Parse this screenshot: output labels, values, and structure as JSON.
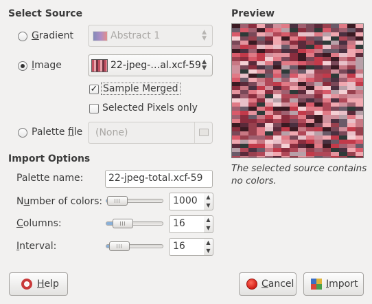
{
  "select_source": {
    "title": "Select Source",
    "gradient": {
      "label": "Gradient",
      "value": "Abstract 1",
      "checked": false
    },
    "image": {
      "label": "Image",
      "value": "22-jpeg-…al.xcf-59",
      "checked": true
    },
    "sample_merged": {
      "label": "Sample Merged",
      "checked": true
    },
    "selected_pixels_only": {
      "label": "Selected Pixels only",
      "checked": false
    },
    "palette_file": {
      "label": "Palette file",
      "value": "(None)",
      "checked": false
    }
  },
  "preview": {
    "title": "Preview",
    "caption_line1": "The selected source contains",
    "caption_line2": "no colors."
  },
  "import_options": {
    "title": "Import Options",
    "palette_name": {
      "label": "Palette name:",
      "value": "22-jpeg-total.xcf-59"
    },
    "number_of_colors": {
      "label": "Number of colors:",
      "value": "1000",
      "level": 0.02
    },
    "columns": {
      "label": "Columns:",
      "value": "16",
      "level": 0.12
    },
    "interval": {
      "label": "Interval:",
      "value": "16",
      "level": 0.06
    }
  },
  "buttons": {
    "help": "Help",
    "cancel": "Cancel",
    "import": "Import"
  },
  "icons": {
    "help": "help-lifebuoy-icon",
    "cancel": "cancel-stop-icon",
    "import": "import-icon",
    "folder": "folder-icon",
    "combo_arrows": "up-down-arrows-icon"
  },
  "colors": {
    "gradient_swatch": [
      "#2b3a8e",
      "#7b3fa6",
      "#d8423c"
    ],
    "preview_palette": [
      "#c23a4a",
      "#e07a86",
      "#8a2d3e",
      "#d85a6a",
      "#f0a8b0",
      "#5a2a3a",
      "#b04858",
      "#e8c0c8",
      "#7a4858",
      "#3a1a22",
      "#d0909c",
      "#a06070",
      "#f4d0d4",
      "#6a5a68",
      "#c87884",
      "#98404e",
      "#e4949e",
      "#4a3040",
      "#b8a0a8",
      "#2e3a38"
    ]
  }
}
